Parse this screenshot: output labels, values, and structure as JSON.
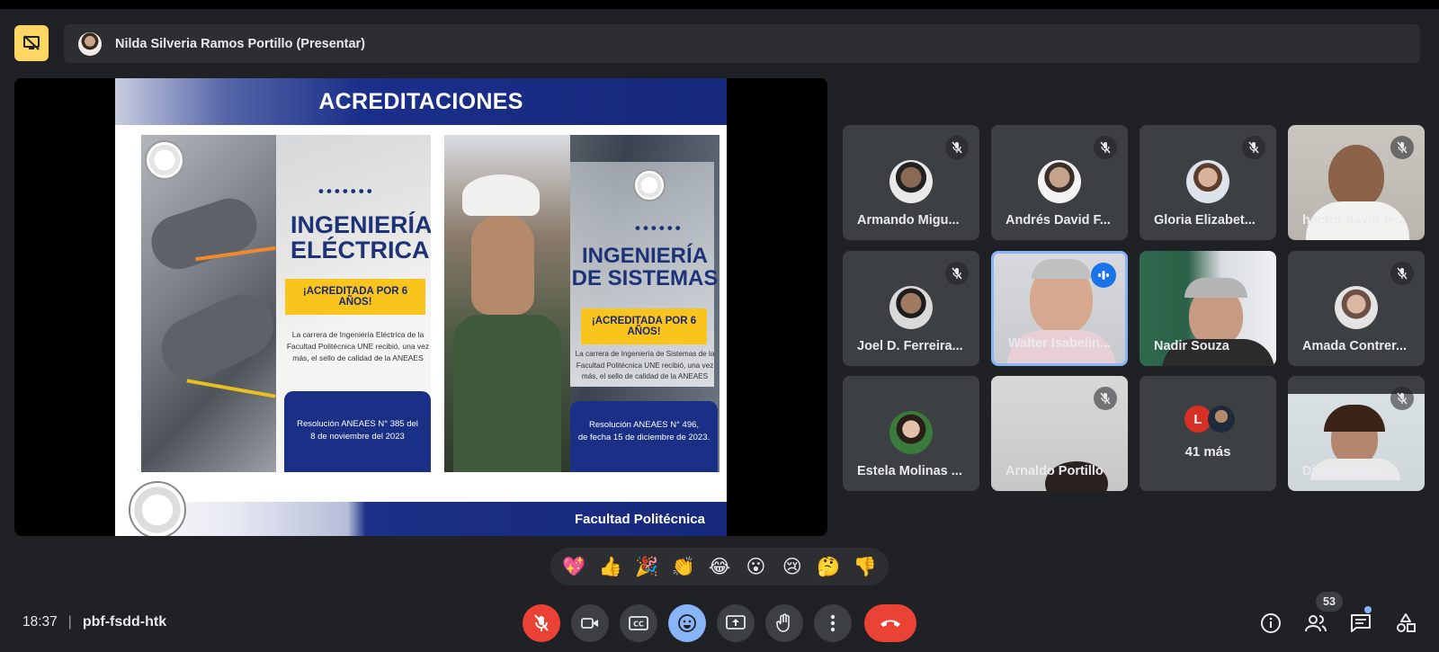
{
  "presenter": {
    "name": "Nilda Silveria Ramos Portillo (Presentar)"
  },
  "slide": {
    "title": "ACREDITACIONES",
    "footer": "Facultad Politécnica",
    "poster1": {
      "dots": "•••••••",
      "heading_line1": "INGENIERÍA",
      "heading_line2": "ELÉCTRICA",
      "badge": "¡ACREDITADA POR 6 AÑOS!",
      "body_line1": "La carrera de Ingeniería Eléctrica de la",
      "body_line2": "Facultad Politécnica UNE recibió, una vez",
      "body_line3": "más, el sello de calidad de la ANEAES",
      "resolution_line1": "Resolución ANEAES N° 385 del",
      "resolution_line2": "8 de noviembre del 2023"
    },
    "poster2": {
      "dots": "••••••",
      "heading_line1": "INGENIERÍA",
      "heading_line2": "DE SISTEMAS",
      "badge": "¡ACREDITADA POR 6 AÑOS!",
      "body_line1": "La carrera de Ingeniería de Sistemas de la",
      "body_line2": "Facultad Politécnica UNE recibió, una vez",
      "body_line3": "más, el sello de calidad de la ANEAES",
      "resolution_line1": "Resolución ANEAES N° 496,",
      "resolution_line2": "de fecha 15 de diciembre de 2023."
    }
  },
  "participants": [
    {
      "name": "Armando Migu...",
      "muted": true,
      "video": false
    },
    {
      "name": "Andrés David F...",
      "muted": true,
      "video": false
    },
    {
      "name": "Gloria Elizabet...",
      "muted": true,
      "video": false
    },
    {
      "name": "hector david fe...",
      "muted": true,
      "video": true
    },
    {
      "name": "Joel D. Ferreira...",
      "muted": true,
      "video": false
    },
    {
      "name": "Walter Isabelin...",
      "muted": false,
      "video": true,
      "speaking": true
    },
    {
      "name": "Nadir Souza",
      "muted": false,
      "video": true
    },
    {
      "name": "Amada Contrer...",
      "muted": true,
      "video": false
    },
    {
      "name": "Estela Molinas ...",
      "muted": false,
      "video": false
    },
    {
      "name": "Arnaldo Portillo",
      "muted": true,
      "video": true
    },
    {
      "name": "Diana Fariña",
      "muted": true,
      "video": true
    }
  ],
  "more": {
    "initial": "L",
    "label": "41 más"
  },
  "reactions": [
    "💖",
    "👍",
    "🎉",
    "👏",
    "😂",
    "😮",
    "😢",
    "🤔",
    "👎"
  ],
  "bottom": {
    "time": "18:37",
    "separator": "|",
    "meeting_code": "pbf-fsdd-htk",
    "people_count": "53"
  },
  "colors": {
    "background": "#202124",
    "present_accent": "#fdd663",
    "mic_off_red": "#ea4335",
    "reaction_blue": "#8ab4f8",
    "speaking_blue": "#1a73e8"
  }
}
